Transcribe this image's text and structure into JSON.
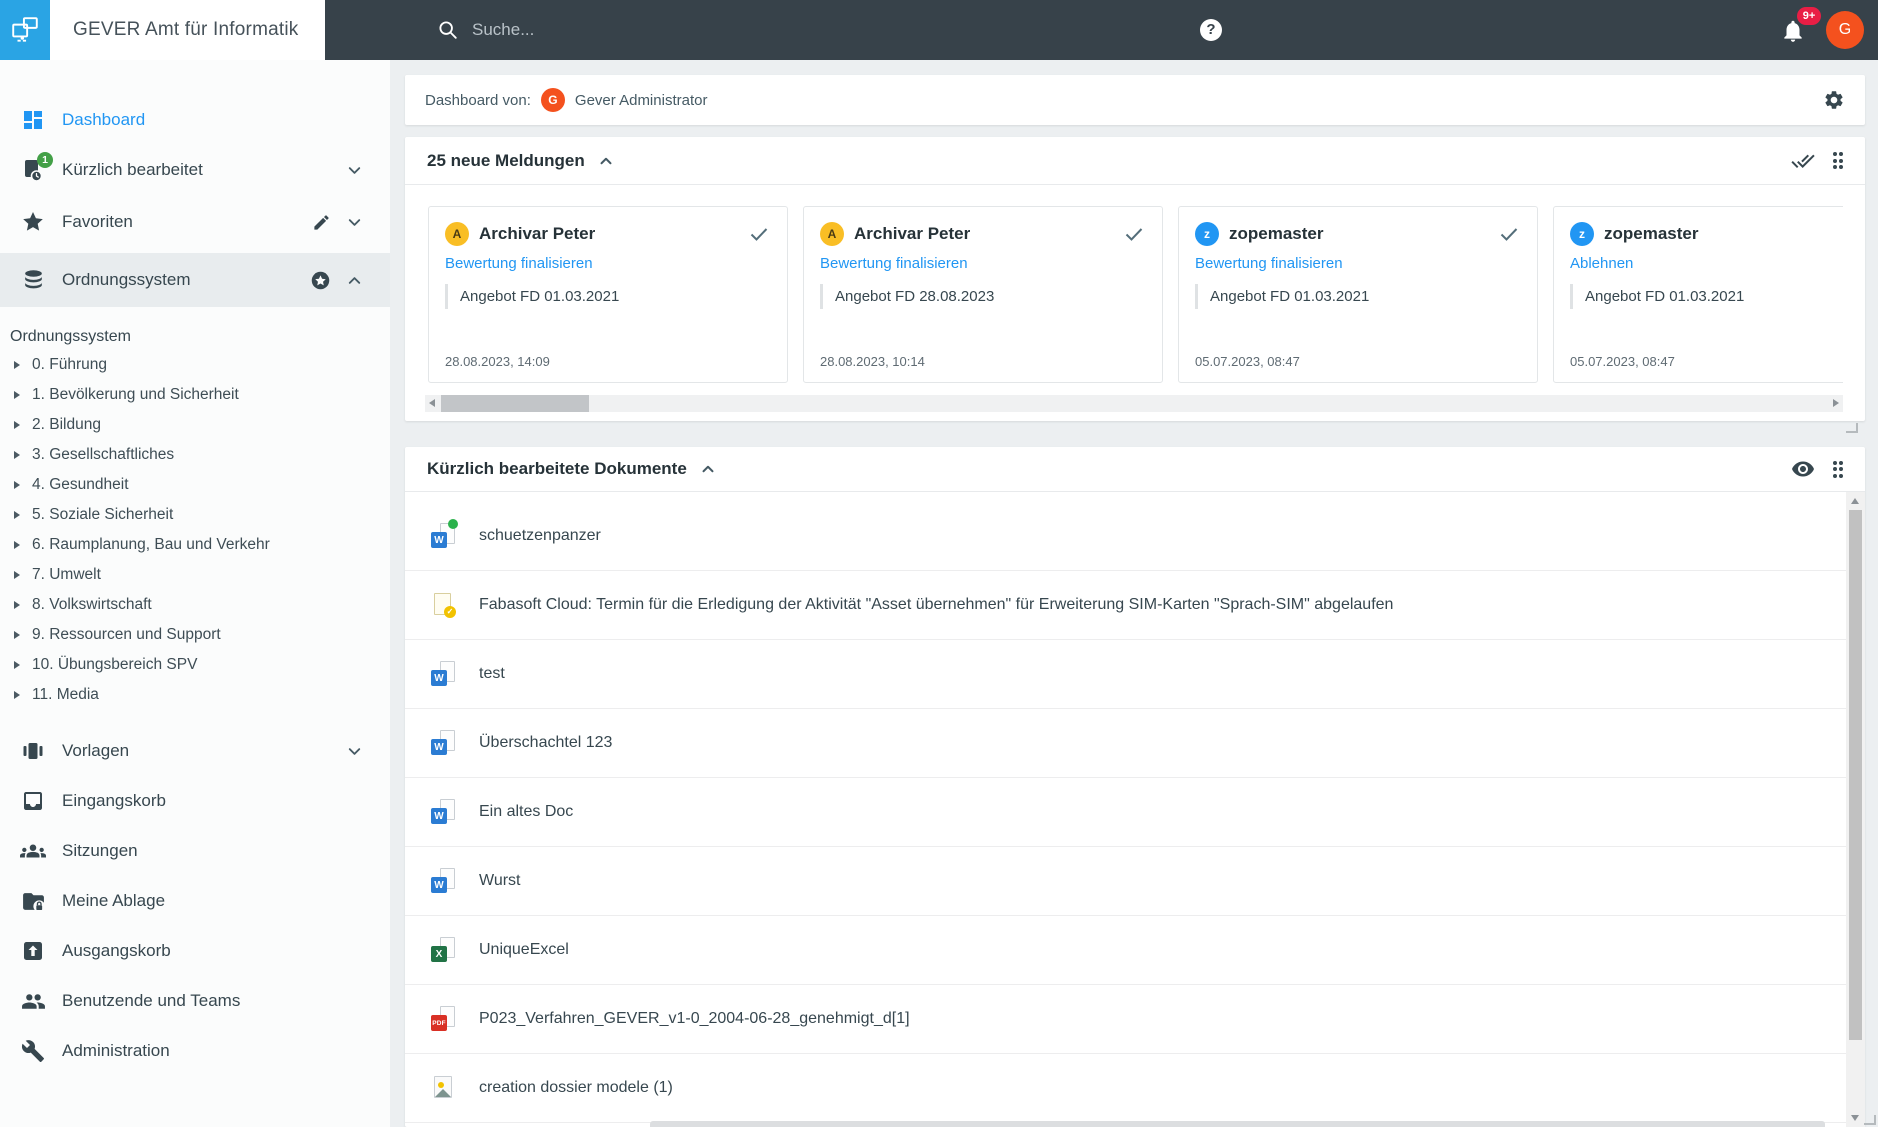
{
  "colors": {
    "accent_blue": "#2196F3",
    "topbar_bg": "#37424A",
    "logo_blue": "#2AA4E4",
    "sidebar_text": "#37474F",
    "selected_row_bg": "#E8ECEE",
    "page_bg": "#ECEFF1",
    "badge_green": "#43A047",
    "badge_red": "#E91E45",
    "avatar_orange": "#F4511E",
    "avatar_yellow": "#F9BE25",
    "avatar_blue": "#2196F3"
  },
  "topbar": {
    "app_title": "GEVER Amt für Informatik",
    "search_placeholder": "Suche...",
    "help_label": "?",
    "notification_count": "9+",
    "user_initial": "G"
  },
  "sidebar": {
    "primary": [
      {
        "label": "Dashboard"
      },
      {
        "label": "Kürzlich bearbeitet",
        "badge": "1"
      },
      {
        "label": "Favoriten"
      },
      {
        "label": "Ordnungssystem"
      }
    ],
    "tree": {
      "root": "Ordnungssystem",
      "items": [
        "0. Führung",
        "1. Bevölkerung und Sicherheit",
        "2. Bildung",
        "3. Gesellschaftliches",
        "4. Gesundheit",
        "5. Soziale Sicherheit",
        "6. Raumplanung, Bau und Verkehr",
        "7. Umwelt",
        "8. Volkswirtschaft",
        "9. Ressourcen und Support",
        "10. Übungsbereich SPV",
        "11. Media"
      ]
    },
    "secondary": [
      {
        "label": "Vorlagen"
      },
      {
        "label": "Eingangskorb"
      },
      {
        "label": "Sitzungen"
      },
      {
        "label": "Meine Ablage"
      },
      {
        "label": "Ausgangskorb"
      },
      {
        "label": "Benutzende und Teams"
      },
      {
        "label": "Administration"
      }
    ]
  },
  "user_bar": {
    "label": "Dashboard von:",
    "user_initial": "G",
    "user_name": "Gever Administrator"
  },
  "notifications": {
    "title": "25 neue Meldungen",
    "cards": [
      {
        "initial": "A",
        "name": "Archivar Peter",
        "action": "Bewertung finalisieren",
        "subject": "Angebot FD 01.03.2021",
        "timestamp": "28.08.2023, 14:09",
        "avatar_bg": "#F9BE25",
        "avatar_fg": "#4a3b14"
      },
      {
        "initial": "A",
        "name": "Archivar Peter",
        "action": "Bewertung finalisieren",
        "subject": "Angebot FD 28.08.2023",
        "timestamp": "28.08.2023, 10:14",
        "avatar_bg": "#F9BE25",
        "avatar_fg": "#4a3b14"
      },
      {
        "initial": "z",
        "name": "zopemaster",
        "action": "Bewertung finalisieren",
        "subject": "Angebot FD 01.03.2021",
        "timestamp": "05.07.2023, 08:47",
        "avatar_bg": "#2196F3",
        "avatar_fg": "#ffffff"
      },
      {
        "initial": "z",
        "name": "zopemaster",
        "action": "Ablehnen",
        "subject": "Angebot FD 01.03.2021",
        "timestamp": "05.07.2023, 08:47",
        "avatar_bg": "#2196F3",
        "avatar_fg": "#ffffff"
      }
    ]
  },
  "documents": {
    "title": "Kürzlich bearbeitete Dokumente",
    "file_letters": {
      "word": "W",
      "excel": "X",
      "pdf": "PDF",
      "mail_check": "✓"
    },
    "items": [
      {
        "name": "schuetzenpanzer",
        "type": "word"
      },
      {
        "name": "Fabasoft Cloud: Termin für die Erledigung der Aktivität \"Asset übernehmen\" für Erweiterung SIM-Karten \"Sprach-SIM\" abgelaufen",
        "type": "email"
      },
      {
        "name": "test",
        "type": "word"
      },
      {
        "name": "Überschachtel 123",
        "type": "word"
      },
      {
        "name": "Ein altes Doc",
        "type": "word"
      },
      {
        "name": "Wurst",
        "type": "word"
      },
      {
        "name": "UniqueExcel",
        "type": "excel"
      },
      {
        "name": "P023_Verfahren_GEVER_v1-0_2004-06-28_genehmigt_d[1]",
        "type": "pdf"
      },
      {
        "name": "creation dossier modele (1)",
        "type": "image"
      }
    ]
  }
}
